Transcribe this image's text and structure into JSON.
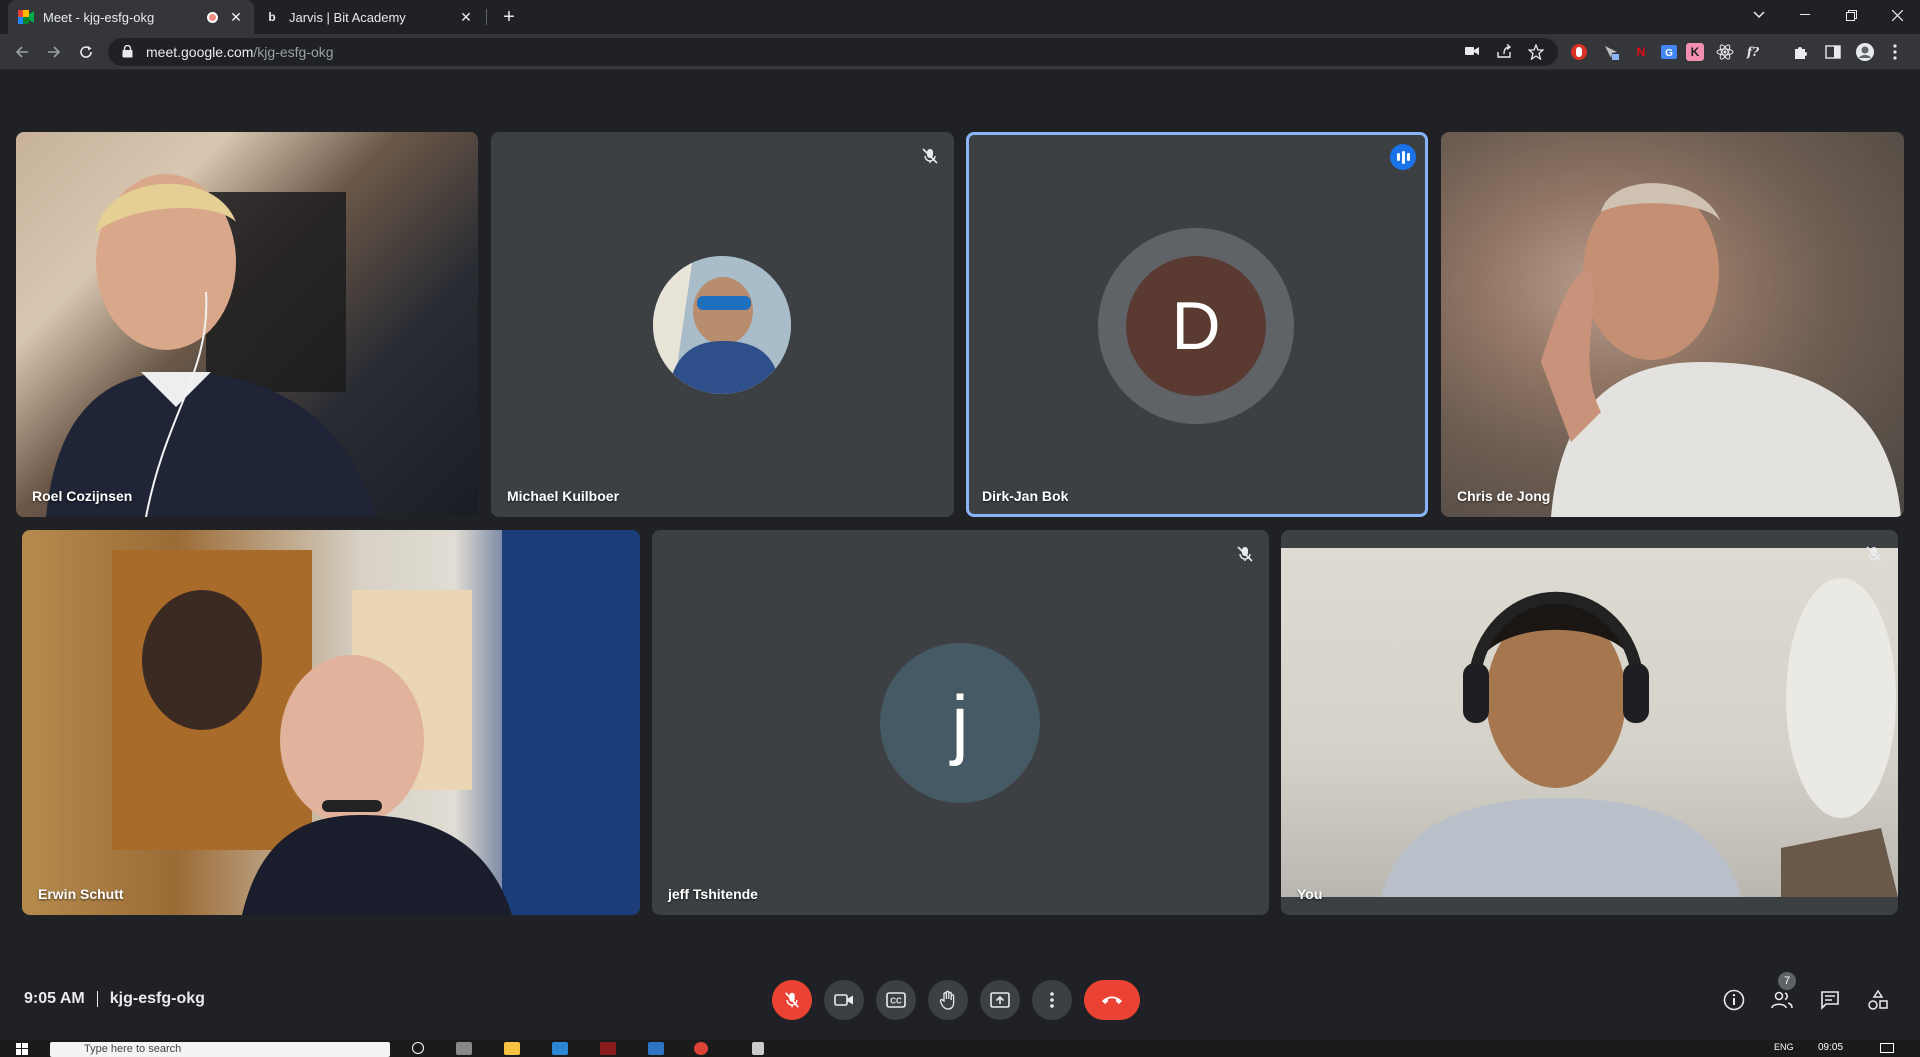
{
  "browser": {
    "tabs": [
      {
        "title": "Meet - kjg-esfg-okg",
        "active": true
      },
      {
        "title": "Jarvis | Bit Academy",
        "favicon_letter": "b",
        "active": false
      }
    ],
    "url_host": "meet.google.com",
    "url_path": "/kjg-esfg-okg",
    "extensions": [
      "video-camera-icon",
      "share-icon",
      "star-icon",
      "red-ext-icon",
      "cursor-ext-icon",
      "netflix-ext-icon",
      "translate-ext-icon",
      "k-ext-icon",
      "react-ext-icon",
      "fx-ext-icon",
      "puzzle-icon",
      "sidepanel-icon",
      "profile-icon",
      "kebab-icon"
    ],
    "ext_netflix": "N",
    "ext_k": "K",
    "ext_fx": "f?"
  },
  "participants": [
    {
      "name": "Roel Cozijnsen",
      "video": true,
      "muted": false
    },
    {
      "name": "Michael Kuilboer",
      "video": false,
      "muted": true,
      "avatar": "photo"
    },
    {
      "name": "Dirk-Jan Bok",
      "video": false,
      "muted": false,
      "speaking": true,
      "initial": "D",
      "avatar_color": "#5b3a32"
    },
    {
      "name": "Chris de Jong",
      "video": true,
      "muted": false
    },
    {
      "name": "Erwin Schutt",
      "video": true,
      "muted": false
    },
    {
      "name": "jeff Tshitende",
      "video": false,
      "muted": true,
      "initial": "j",
      "avatar_color": "#455a64"
    },
    {
      "name": "You",
      "video": true,
      "muted": true
    }
  ],
  "meeting": {
    "time": "9:05 AM",
    "code": "kjg-esfg-okg",
    "people_count": "7"
  },
  "colors": {
    "end_call": "#ea4335",
    "active_speaker": "#8ab4f8",
    "background": "#202124"
  },
  "taskbar": {
    "search_placeholder": "Type here to search",
    "time": "09:05",
    "lang": "ENG"
  }
}
